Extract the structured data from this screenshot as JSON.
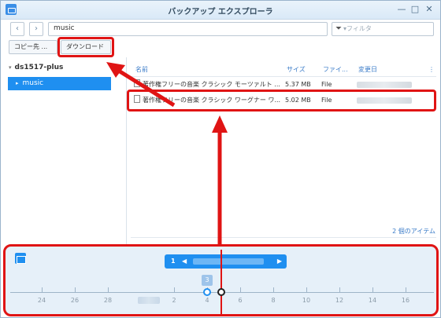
{
  "window": {
    "title": "バックアップ エクスプローラ"
  },
  "nav": {
    "back": "‹",
    "forward": "›",
    "path_value": "music",
    "filter_placeholder": "▾フィルタ"
  },
  "toolbar": {
    "copy_to_label": "コピー先 ...",
    "download_label": "ダウンロード"
  },
  "sidebar": {
    "root_label": "ds1517-plus",
    "items": [
      {
        "label": "music"
      }
    ]
  },
  "filelist": {
    "headers": {
      "name": "名前",
      "size": "サイズ",
      "type": "ファイ...",
      "modified": "変更日"
    },
    "rows": [
      {
        "name": "著作権フリーの音楽 クラシック モーツァルト ...",
        "size": "5.37 MB",
        "type": "File"
      },
      {
        "name": "著作権フリーの音楽 クラシック ワーグナー ワ...",
        "size": "5.02 MB",
        "type": "File"
      }
    ],
    "count": "2 個のアイテム"
  },
  "timeline": {
    "date_badge": "1",
    "version_count": "3",
    "ticks": [
      "24",
      "26",
      "28",
      "2",
      "4",
      "6",
      "8",
      "10",
      "12",
      "14",
      "16"
    ]
  },
  "colors": {
    "accent": "#1f8ff0",
    "highlight": "#e01414"
  }
}
